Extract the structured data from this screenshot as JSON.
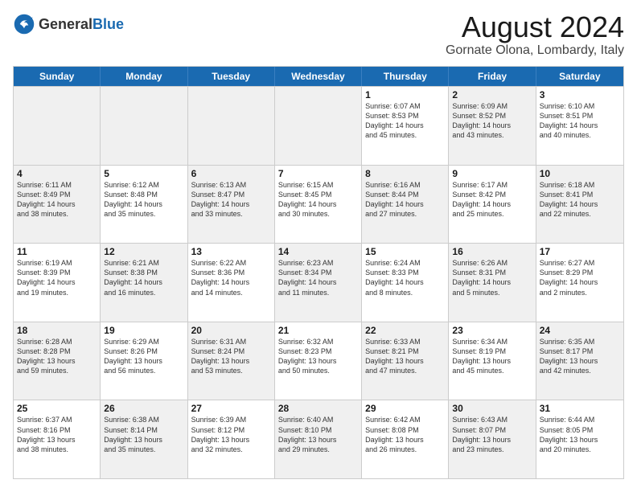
{
  "header": {
    "logo_general": "General",
    "logo_blue": "Blue",
    "month_title": "August 2024",
    "location": "Gornate Olona, Lombardy, Italy"
  },
  "weekdays": [
    "Sunday",
    "Monday",
    "Tuesday",
    "Wednesday",
    "Thursday",
    "Friday",
    "Saturday"
  ],
  "rows": [
    [
      {
        "day": "",
        "info": "",
        "shaded": true
      },
      {
        "day": "",
        "info": "",
        "shaded": true
      },
      {
        "day": "",
        "info": "",
        "shaded": true
      },
      {
        "day": "",
        "info": "",
        "shaded": true
      },
      {
        "day": "1",
        "info": "Sunrise: 6:07 AM\nSunset: 8:53 PM\nDaylight: 14 hours\nand 45 minutes.",
        "shaded": false
      },
      {
        "day": "2",
        "info": "Sunrise: 6:09 AM\nSunset: 8:52 PM\nDaylight: 14 hours\nand 43 minutes.",
        "shaded": true
      },
      {
        "day": "3",
        "info": "Sunrise: 6:10 AM\nSunset: 8:51 PM\nDaylight: 14 hours\nand 40 minutes.",
        "shaded": false
      }
    ],
    [
      {
        "day": "4",
        "info": "Sunrise: 6:11 AM\nSunset: 8:49 PM\nDaylight: 14 hours\nand 38 minutes.",
        "shaded": true
      },
      {
        "day": "5",
        "info": "Sunrise: 6:12 AM\nSunset: 8:48 PM\nDaylight: 14 hours\nand 35 minutes.",
        "shaded": false
      },
      {
        "day": "6",
        "info": "Sunrise: 6:13 AM\nSunset: 8:47 PM\nDaylight: 14 hours\nand 33 minutes.",
        "shaded": true
      },
      {
        "day": "7",
        "info": "Sunrise: 6:15 AM\nSunset: 8:45 PM\nDaylight: 14 hours\nand 30 minutes.",
        "shaded": false
      },
      {
        "day": "8",
        "info": "Sunrise: 6:16 AM\nSunset: 8:44 PM\nDaylight: 14 hours\nand 27 minutes.",
        "shaded": true
      },
      {
        "day": "9",
        "info": "Sunrise: 6:17 AM\nSunset: 8:42 PM\nDaylight: 14 hours\nand 25 minutes.",
        "shaded": false
      },
      {
        "day": "10",
        "info": "Sunrise: 6:18 AM\nSunset: 8:41 PM\nDaylight: 14 hours\nand 22 minutes.",
        "shaded": true
      }
    ],
    [
      {
        "day": "11",
        "info": "Sunrise: 6:19 AM\nSunset: 8:39 PM\nDaylight: 14 hours\nand 19 minutes.",
        "shaded": false
      },
      {
        "day": "12",
        "info": "Sunrise: 6:21 AM\nSunset: 8:38 PM\nDaylight: 14 hours\nand 16 minutes.",
        "shaded": true
      },
      {
        "day": "13",
        "info": "Sunrise: 6:22 AM\nSunset: 8:36 PM\nDaylight: 14 hours\nand 14 minutes.",
        "shaded": false
      },
      {
        "day": "14",
        "info": "Sunrise: 6:23 AM\nSunset: 8:34 PM\nDaylight: 14 hours\nand 11 minutes.",
        "shaded": true
      },
      {
        "day": "15",
        "info": "Sunrise: 6:24 AM\nSunset: 8:33 PM\nDaylight: 14 hours\nand 8 minutes.",
        "shaded": false
      },
      {
        "day": "16",
        "info": "Sunrise: 6:26 AM\nSunset: 8:31 PM\nDaylight: 14 hours\nand 5 minutes.",
        "shaded": true
      },
      {
        "day": "17",
        "info": "Sunrise: 6:27 AM\nSunset: 8:29 PM\nDaylight: 14 hours\nand 2 minutes.",
        "shaded": false
      }
    ],
    [
      {
        "day": "18",
        "info": "Sunrise: 6:28 AM\nSunset: 8:28 PM\nDaylight: 13 hours\nand 59 minutes.",
        "shaded": true
      },
      {
        "day": "19",
        "info": "Sunrise: 6:29 AM\nSunset: 8:26 PM\nDaylight: 13 hours\nand 56 minutes.",
        "shaded": false
      },
      {
        "day": "20",
        "info": "Sunrise: 6:31 AM\nSunset: 8:24 PM\nDaylight: 13 hours\nand 53 minutes.",
        "shaded": true
      },
      {
        "day": "21",
        "info": "Sunrise: 6:32 AM\nSunset: 8:23 PM\nDaylight: 13 hours\nand 50 minutes.",
        "shaded": false
      },
      {
        "day": "22",
        "info": "Sunrise: 6:33 AM\nSunset: 8:21 PM\nDaylight: 13 hours\nand 47 minutes.",
        "shaded": true
      },
      {
        "day": "23",
        "info": "Sunrise: 6:34 AM\nSunset: 8:19 PM\nDaylight: 13 hours\nand 45 minutes.",
        "shaded": false
      },
      {
        "day": "24",
        "info": "Sunrise: 6:35 AM\nSunset: 8:17 PM\nDaylight: 13 hours\nand 42 minutes.",
        "shaded": true
      }
    ],
    [
      {
        "day": "25",
        "info": "Sunrise: 6:37 AM\nSunset: 8:16 PM\nDaylight: 13 hours\nand 38 minutes.",
        "shaded": false
      },
      {
        "day": "26",
        "info": "Sunrise: 6:38 AM\nSunset: 8:14 PM\nDaylight: 13 hours\nand 35 minutes.",
        "shaded": true
      },
      {
        "day": "27",
        "info": "Sunrise: 6:39 AM\nSunset: 8:12 PM\nDaylight: 13 hours\nand 32 minutes.",
        "shaded": false
      },
      {
        "day": "28",
        "info": "Sunrise: 6:40 AM\nSunset: 8:10 PM\nDaylight: 13 hours\nand 29 minutes.",
        "shaded": true
      },
      {
        "day": "29",
        "info": "Sunrise: 6:42 AM\nSunset: 8:08 PM\nDaylight: 13 hours\nand 26 minutes.",
        "shaded": false
      },
      {
        "day": "30",
        "info": "Sunrise: 6:43 AM\nSunset: 8:07 PM\nDaylight: 13 hours\nand 23 minutes.",
        "shaded": true
      },
      {
        "day": "31",
        "info": "Sunrise: 6:44 AM\nSunset: 8:05 PM\nDaylight: 13 hours\nand 20 minutes.",
        "shaded": false
      }
    ]
  ]
}
